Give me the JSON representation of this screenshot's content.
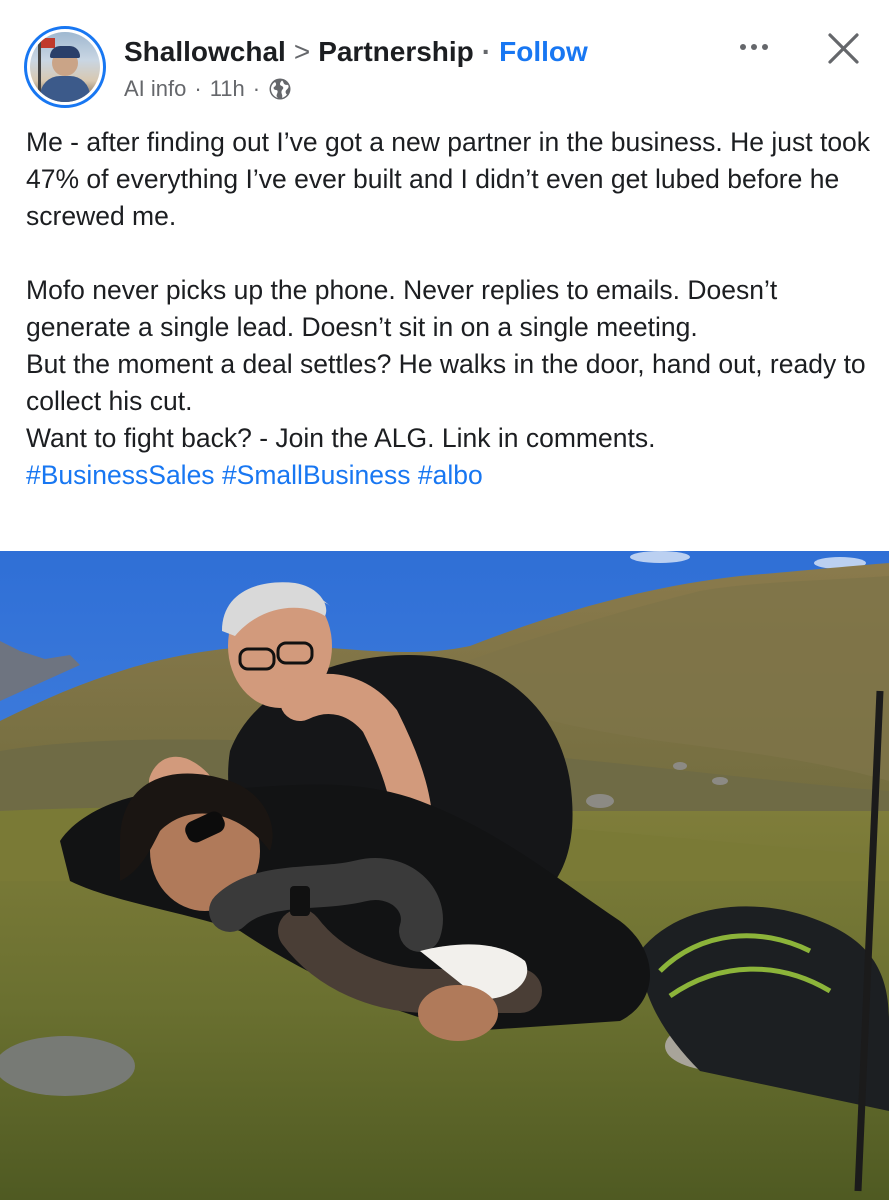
{
  "post": {
    "author": "Shallowchal",
    "separator": ">",
    "group": "Partnership",
    "dot": "·",
    "follow_label": "Follow",
    "ai_info": "AI info",
    "meta_dot": "·",
    "time": "11h",
    "meta_dot2": "·",
    "icons": {
      "avatar": "profile-avatar",
      "more": "more-options-icon",
      "close": "close-icon",
      "audience": "globe-icon"
    },
    "text_paragraph_1": "Me - after finding out I’ve got a new partner in the business. He just took 47% of everything I’ve ever built and I didn’t even get lubed before he screwed me.",
    "text_line_2": "Mofo never picks up the phone. Never replies to emails. Doesn’t generate a single lead. Doesn’t sit in on a single meeting.",
    "text_line_3": "But the moment a deal settles? He walks in the door, hand out, ready to collect his cut.",
    "text_line_4": "Want to fight back? - Join the ALG. Link in comments.",
    "hashtags": [
      "#BusinessSales",
      "#SmallBusiness",
      "#albo"
    ],
    "colors": {
      "accent": "#1877f2",
      "text": "#1c1e21",
      "muted": "#65676b"
    }
  }
}
